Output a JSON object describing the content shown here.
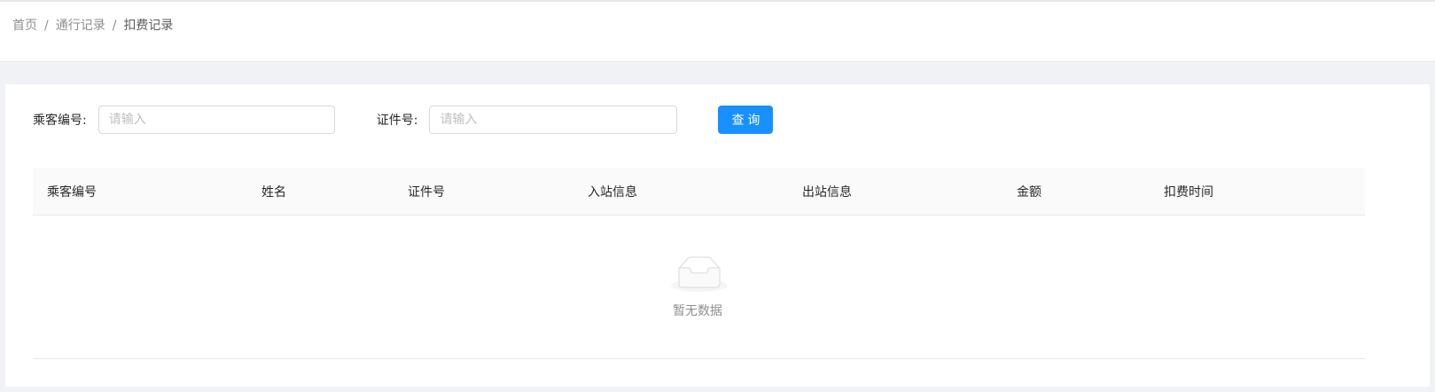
{
  "breadcrumb": {
    "items": [
      "首页",
      "通行记录",
      "扣费记录"
    ],
    "separator": "/"
  },
  "search": {
    "passenger_no_label": "乘客编号:",
    "passenger_no_placeholder": "请输入",
    "passenger_no_value": "",
    "id_no_label": "证件号:",
    "id_no_placeholder": "请输入",
    "id_no_value": "",
    "query_button": "查询"
  },
  "table": {
    "columns": [
      "乘客编号",
      "姓名",
      "证件号",
      "入站信息",
      "出站信息",
      "金额",
      "扣费时间"
    ],
    "rows": [],
    "empty_text": "暂无数据"
  },
  "colors": {
    "primary": "#1890ff",
    "page_background": "#f0f2f5",
    "header_background": "#fafafa"
  },
  "icons": {
    "empty": "empty-inbox-icon"
  }
}
